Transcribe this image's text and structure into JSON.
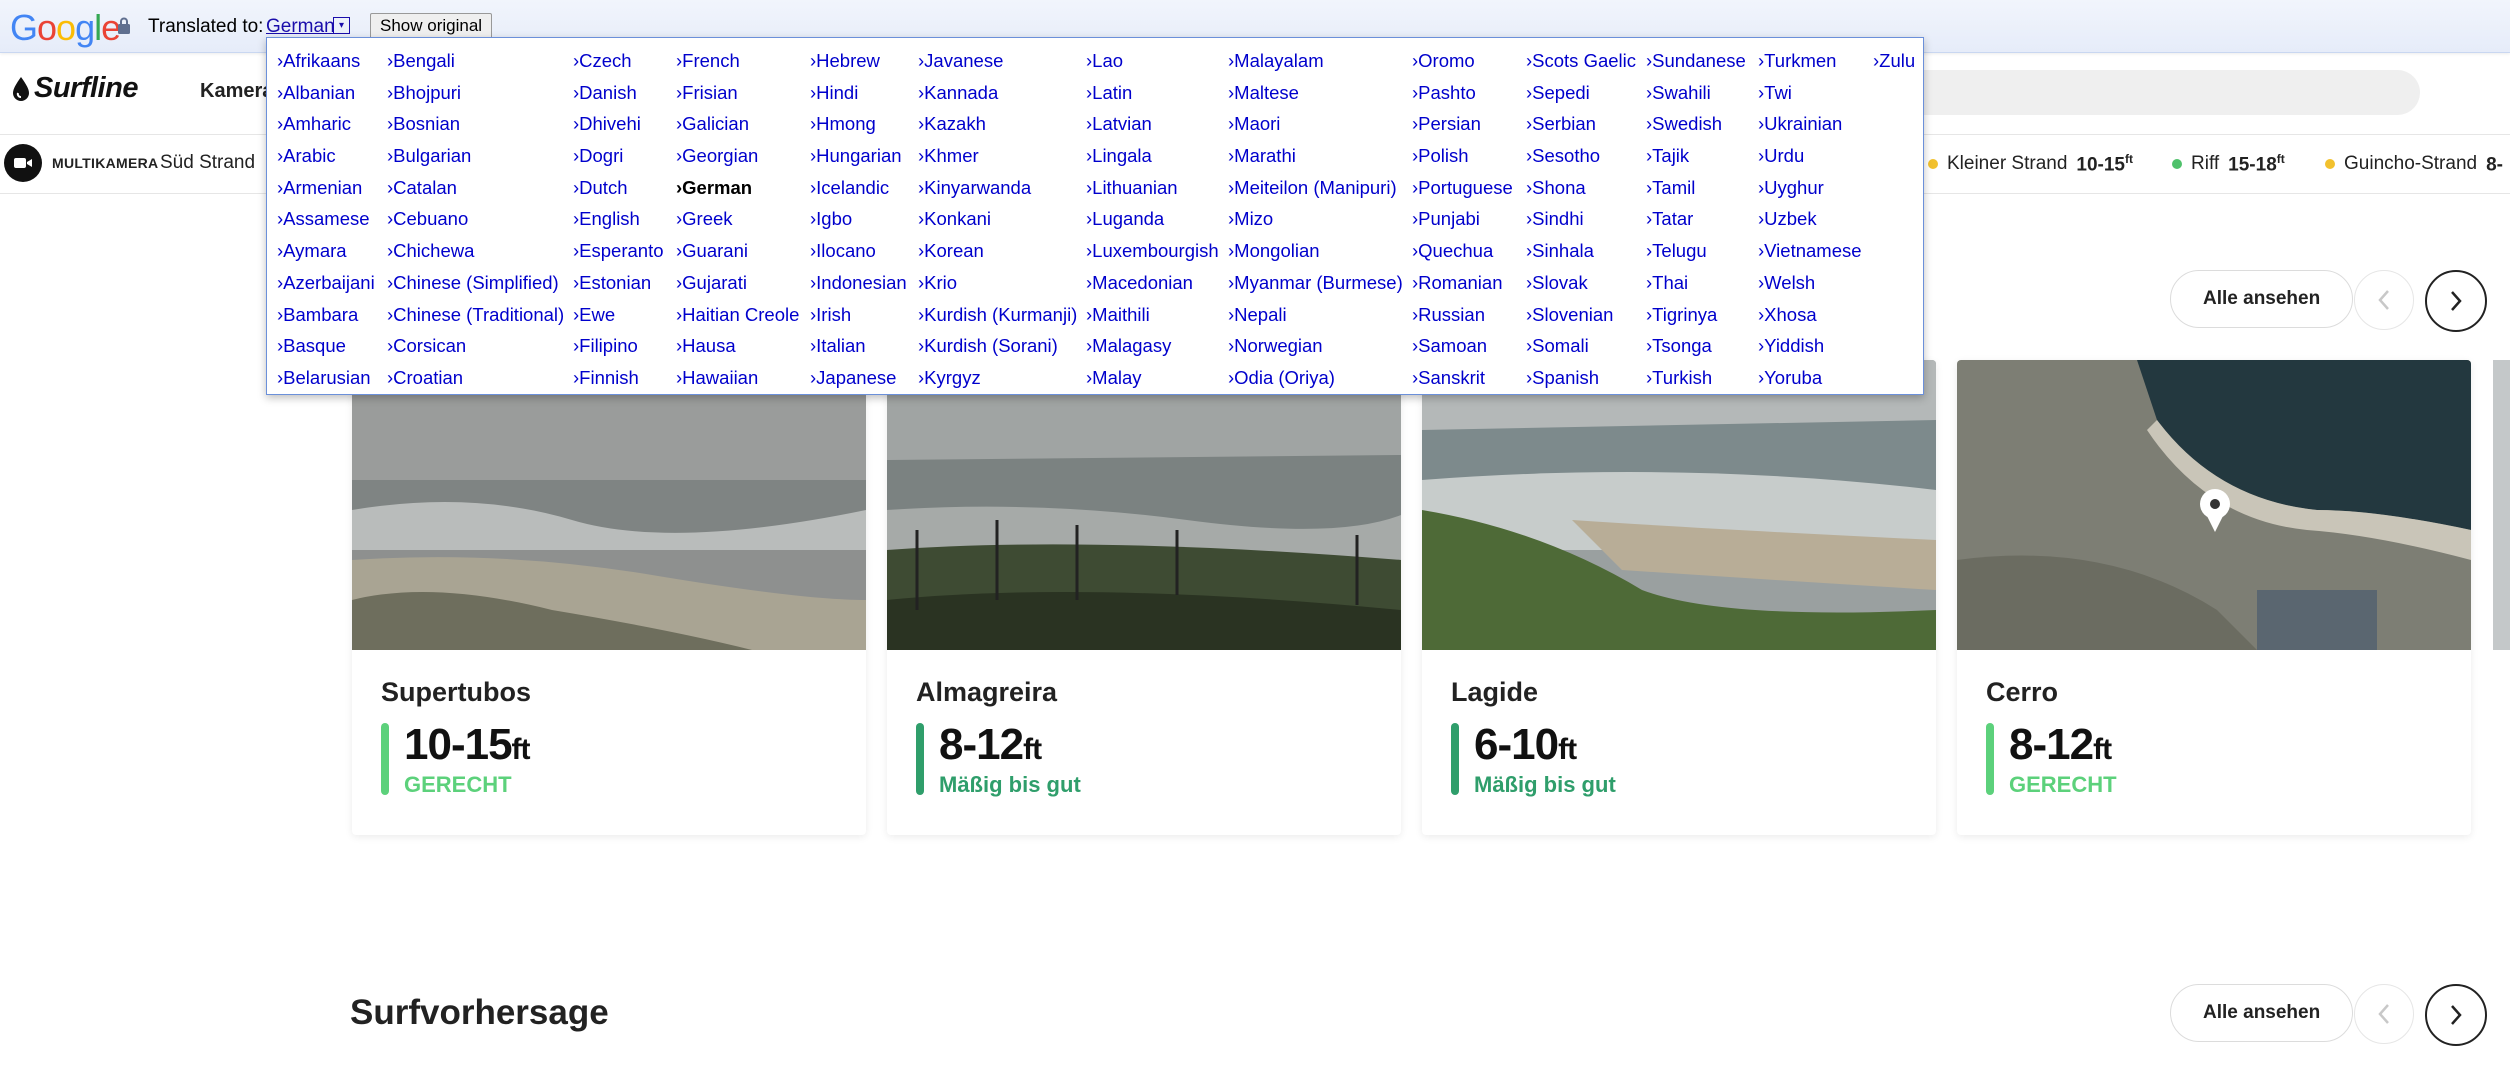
{
  "translate_bar": {
    "label": "Translated to:",
    "language": "German",
    "caret": "▾",
    "show_original": "Show original"
  },
  "language_menu": {
    "selected": "German",
    "columns": [
      [
        "›Afrikaans",
        "›Albanian",
        "›Amharic",
        "›Arabic",
        "›Armenian",
        "›Assamese",
        "›Aymara",
        "›Azerbaijani",
        "›Bambara",
        "›Basque",
        "›Belarusian"
      ],
      [
        "›Bengali",
        "›Bhojpuri",
        "›Bosnian",
        "›Bulgarian",
        "›Catalan",
        "›Cebuano",
        "›Chichewa",
        "›Chinese (Simplified)",
        "›Chinese (Traditional)",
        "›Corsican",
        "›Croatian"
      ],
      [
        "›Czech",
        "›Danish",
        "›Dhivehi",
        "›Dogri",
        "›Dutch",
        "›English",
        "›Esperanto",
        "›Estonian",
        "›Ewe",
        "›Filipino",
        "›Finnish"
      ],
      [
        "›French",
        "›Frisian",
        "›Galician",
        "›Georgian",
        "›German",
        "›Greek",
        "›Guarani",
        "›Gujarati",
        "›Haitian Creole",
        "›Hausa",
        "›Hawaiian"
      ],
      [
        "›Hebrew",
        "›Hindi",
        "›Hmong",
        "›Hungarian",
        "›Icelandic",
        "›Igbo",
        "›Ilocano",
        "›Indonesian",
        "›Irish",
        "›Italian",
        "›Japanese"
      ],
      [
        "›Javanese",
        "›Kannada",
        "›Kazakh",
        "›Khmer",
        "›Kinyarwanda",
        "›Konkani",
        "›Korean",
        "›Krio",
        "›Kurdish (Kurmanji)",
        "›Kurdish (Sorani)",
        "›Kyrgyz"
      ],
      [
        "›Lao",
        "›Latin",
        "›Latvian",
        "›Lingala",
        "›Lithuanian",
        "›Luganda",
        "›Luxembourgish",
        "›Macedonian",
        "›Maithili",
        "›Malagasy",
        "›Malay"
      ],
      [
        "›Malayalam",
        "›Maltese",
        "›Maori",
        "›Marathi",
        "›Meiteilon (Manipuri)",
        "›Mizo",
        "›Mongolian",
        "›Myanmar (Burmese)",
        "›Nepali",
        "›Norwegian",
        "›Odia (Oriya)"
      ],
      [
        "›Oromo",
        "›Pashto",
        "›Persian",
        "›Polish",
        "›Portuguese",
        "›Punjabi",
        "›Quechua",
        "›Romanian",
        "›Russian",
        "›Samoan",
        "›Sanskrit"
      ],
      [
        "›Scots Gaelic",
        "›Sepedi",
        "›Serbian",
        "›Sesotho",
        "›Shona",
        "›Sindhi",
        "›Sinhala",
        "›Slovak",
        "›Slovenian",
        "›Somali",
        "›Spanish"
      ],
      [
        "›Sundanese",
        "›Swahili",
        "›Swedish",
        "›Tajik",
        "›Tamil",
        "›Tatar",
        "›Telugu",
        "›Thai",
        "›Tigrinya",
        "›Tsonga",
        "›Turkish"
      ],
      [
        "›Turkmen",
        "›Twi",
        "›Ukrainian",
        "›Urdu",
        "›Uyghur",
        "›Uzbek",
        "›Vietnamese",
        "›Welsh",
        "›Xhosa",
        "›Yiddish",
        "›Yoruba"
      ],
      [
        "›Zulu"
      ]
    ]
  },
  "header": {
    "logo": "Surfline",
    "nav_label": "Kamera"
  },
  "ticker": {
    "multi_label": "MULTIKAMERA",
    "multi_spot": "Süd Strand",
    "spots": [
      {
        "name": "Kleiner Strand",
        "height": "10-15",
        "unit": "ft",
        "color": "#f2c12e"
      },
      {
        "name": "Riff",
        "height": "15-18",
        "unit": "ft",
        "color": "#4fc16b"
      },
      {
        "name": "Guincho-Strand",
        "height": "8-",
        "unit": "",
        "color": "#f2c12e"
      }
    ]
  },
  "cams_section": {
    "see_all": "Alle ansehen",
    "prev_icon": "chevron-left-icon",
    "next_icon": "chevron-right-icon"
  },
  "cards": [
    {
      "name": "Supertubos",
      "height": "10-15",
      "unit": "ft",
      "condition": "GERECHT",
      "color": "#5cd17b"
    },
    {
      "name": "Almagreira",
      "height": "8-12",
      "unit": "ft",
      "condition": "Mäßig bis gut",
      "color": "#2f9e6b"
    },
    {
      "name": "Lagide",
      "height": "6-10",
      "unit": "ft",
      "condition": "Mäßig bis gut",
      "color": "#2f9e6b"
    },
    {
      "name": "Cerro",
      "height": "8-12",
      "unit": "ft",
      "condition": "GERECHT",
      "color": "#5cd17b"
    }
  ],
  "forecast_section": {
    "title": "Surfvorhersage",
    "see_all": "Alle ansehen"
  },
  "colors": {
    "link_blue": "#0000cc",
    "fair_green": "#5cd17b",
    "fairgood_green": "#2f9e6b"
  }
}
